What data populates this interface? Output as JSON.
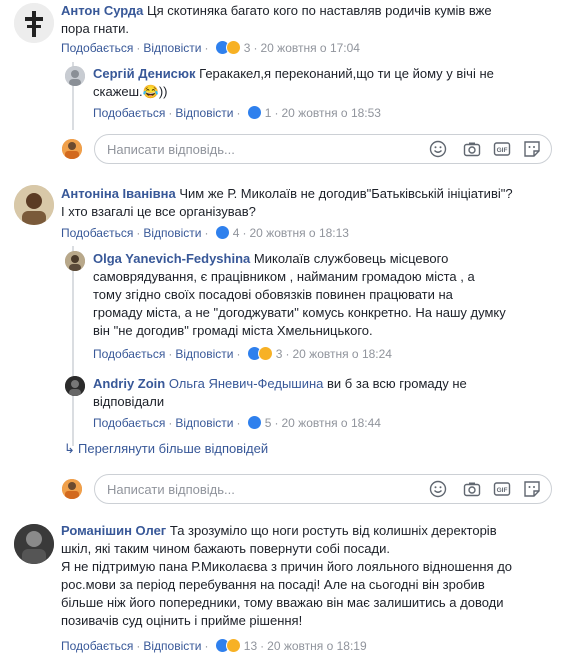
{
  "thread": {
    "comments": [
      {
        "author": "Антон Сурда",
        "lines": [
          "Ця скотиняка багато кого по наставляв родичів кумів вже",
          "пора гнати."
        ],
        "like_label": "Подобається",
        "reply_label": "Відповісти",
        "reaction_count": "3",
        "timestamp": "20 жовтня о 17:04",
        "replies": [
          {
            "author": "Сергій Денисюк",
            "lines": [
              "Геракакел,я переконаний,що ти це йому у вічі не",
              "скажеш.😂))"
            ],
            "like_label": "Подобається",
            "reply_label": "Відповісти",
            "reaction_count": "1",
            "timestamp": "20 жовтня о 18:53"
          }
        ]
      },
      {
        "author": "Антоніна Іванівна",
        "lines": [
          "Чим же Р. Миколаїв не догодив\"Батьківській ініціативі\"?",
          "І хто взагалі це все організував?"
        ],
        "like_label": "Подобається",
        "reply_label": "Відповісти",
        "reaction_count": "4",
        "timestamp": "20 жовтня о 18:13",
        "replies": [
          {
            "author": "Olga Yanevich-Fedyshina",
            "lines": [
              "Миколаїв службовець місцевого",
              "самоврядування, є працівником , найманим громадою міста , а",
              "тому згідно своїх посадові обовязків повинен працювати на",
              "громаду міста, а не \"догоджувати\" комусь конкретно. На нашу думку",
              "він \"не догодив\" громаді міста Хмельницького."
            ],
            "like_label": "Подобається",
            "reply_label": "Відповісти",
            "reaction_count": "3",
            "timestamp": "20 жовтня о 18:24"
          },
          {
            "author": "Andriy Zoin",
            "mention": "Ольга Яневич-Федышина",
            "lines": [
              "ви б за всю громаду не",
              "відповідали"
            ],
            "like_label": "Подобається",
            "reply_label": "Відповісти",
            "reaction_count": "5",
            "timestamp": "20 жовтня о 18:44"
          }
        ],
        "more_replies": "Переглянути більше відповідей"
      },
      {
        "author": "Романішин Олег",
        "lines": [
          "Та зрозуміло що ноги ростуть від колишніх деректорів",
          "шкіл, які таким чином бажають повернути собі посади.",
          "Я не підтримую пана Р.Миколаєва з причин його лояльного відношення до",
          "рос.мови за період перебування на посаді! Але на сьогодні він зробив",
          "більше ніж його попередники, тому вважаю він має залишитись а доводи",
          "позивачів суд оцінить і прийме рішення!"
        ],
        "like_label": "Подобається",
        "reply_label": "Відповісти",
        "reaction_count": "13",
        "timestamp": "20 жовтня о 18:19"
      }
    ],
    "composer": {
      "placeholder": "Написати відповідь..."
    },
    "colors": {
      "link": "#385898",
      "meta": "#90949c",
      "like": "#2f80ed",
      "haha": "#f7b125"
    }
  }
}
